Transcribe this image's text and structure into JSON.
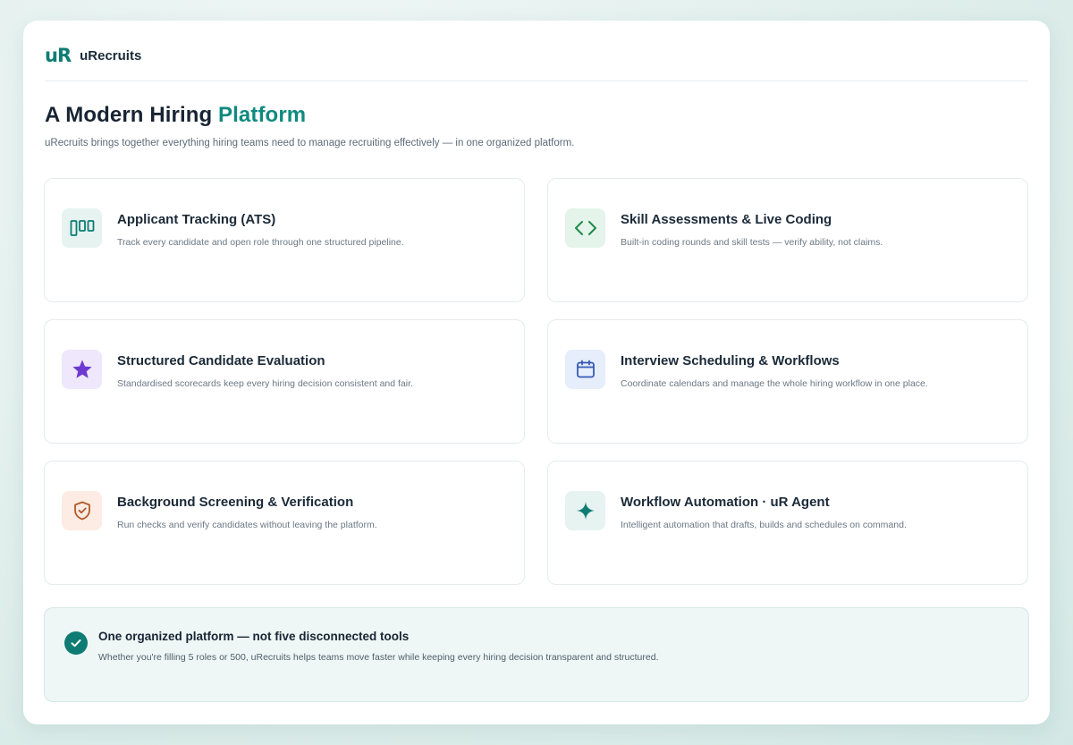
{
  "brand": {
    "logo": "uR",
    "name": "uRecruits"
  },
  "hero": {
    "title_main": "A Modern Hiring ",
    "title_accent": "Platform",
    "subtitle": "uRecruits brings together everything hiring teams need to manage recruiting effectively — in one organized platform."
  },
  "features": [
    {
      "icon": "pipeline-columns-icon",
      "title": "Applicant Tracking (ATS)",
      "desc": "Track every candidate and open role through one structured pipeline."
    },
    {
      "icon": "code-brackets-icon",
      "title": "Skill Assessments & Live Coding",
      "desc": "Built-in coding rounds and skill tests — verify ability, not claims."
    },
    {
      "icon": "star-icon",
      "title": "Structured Candidate Evaluation",
      "desc": "Standardised scorecards keep every hiring decision consistent and fair."
    },
    {
      "icon": "calendar-icon",
      "title": "Interview Scheduling & Workflows",
      "desc": "Coordinate calendars and manage the whole hiring workflow in one place."
    },
    {
      "icon": "shield-check-icon",
      "title": "Background Screening & Verification",
      "desc": "Run checks and verify candidates without leaving the platform."
    },
    {
      "icon": "sparkle-icon",
      "title": "Workflow Automation · uR Agent",
      "desc": "Intelligent automation that drafts, builds and schedules on command."
    }
  ],
  "banner": {
    "title": "One organized platform — not five disconnected tools",
    "desc": "Whether you're filling 5 roles or 500, uRecruits helps teams move faster while keeping every hiring decision transparent and structured."
  },
  "colors": {
    "brand": "#0f7c74",
    "accent": "#0f8a7e",
    "ats_bg": "#e6f3f1",
    "skills_bg": "#e4f4ea",
    "eval_bg": "#efe7fb",
    "sched_bg": "#e6edfb",
    "screen_bg": "#fdece3",
    "auto_bg": "#e6f3f1"
  }
}
